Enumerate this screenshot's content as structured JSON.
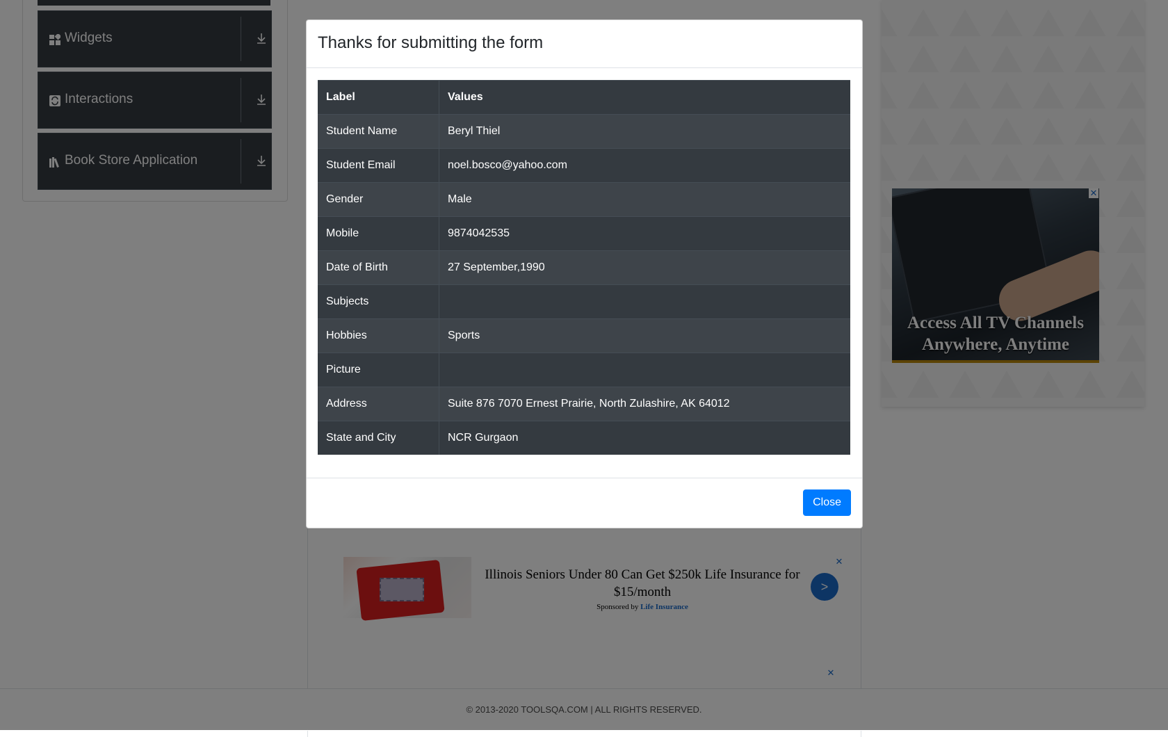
{
  "sidebar": {
    "items": [
      {
        "label": "Widgets",
        "icon": "widgets-icon"
      },
      {
        "label": "Interactions",
        "icon": "interactions-icon"
      },
      {
        "label": "Book Store Application",
        "icon": "book-store-icon"
      }
    ]
  },
  "modal": {
    "title": "Thanks for submitting the form",
    "table": {
      "headers": [
        "Label",
        "Values"
      ],
      "rows": [
        [
          "Student Name",
          "Beryl Thiel"
        ],
        [
          "Student Email",
          "noel.bosco@yahoo.com"
        ],
        [
          "Gender",
          "Male"
        ],
        [
          "Mobile",
          "9874042535"
        ],
        [
          "Date of Birth",
          "27 September,1990"
        ],
        [
          "Subjects",
          ""
        ],
        [
          "Hobbies",
          "Sports"
        ],
        [
          "Picture",
          ""
        ],
        [
          "Address",
          "Suite 876 7070 Ernest Prairie, North Zulashire, AK 64012"
        ],
        [
          "State and City",
          "NCR Gurgaon"
        ]
      ]
    },
    "close_label": "Close"
  },
  "ads": {
    "right": {
      "text_line1": "Access All TV Channels",
      "text_line2": "Anywhere, Anytime",
      "close": "✕"
    },
    "bottom": {
      "title": "Illinois Seniors Under 80 Can Get $250k Life Insurance for $15/month",
      "sponsor_prefix": "Sponsored by",
      "sponsor_link": "Life Insurance",
      "go": ">",
      "close": "✕"
    }
  },
  "footer": {
    "text": "© 2013-2020 TOOLSQA.COM | ALL RIGHTS RESERVED."
  },
  "colors": {
    "primary": "#007bff",
    "table_dark": "#343a40",
    "backdrop": "rgba(0,0,0,0.5)"
  }
}
